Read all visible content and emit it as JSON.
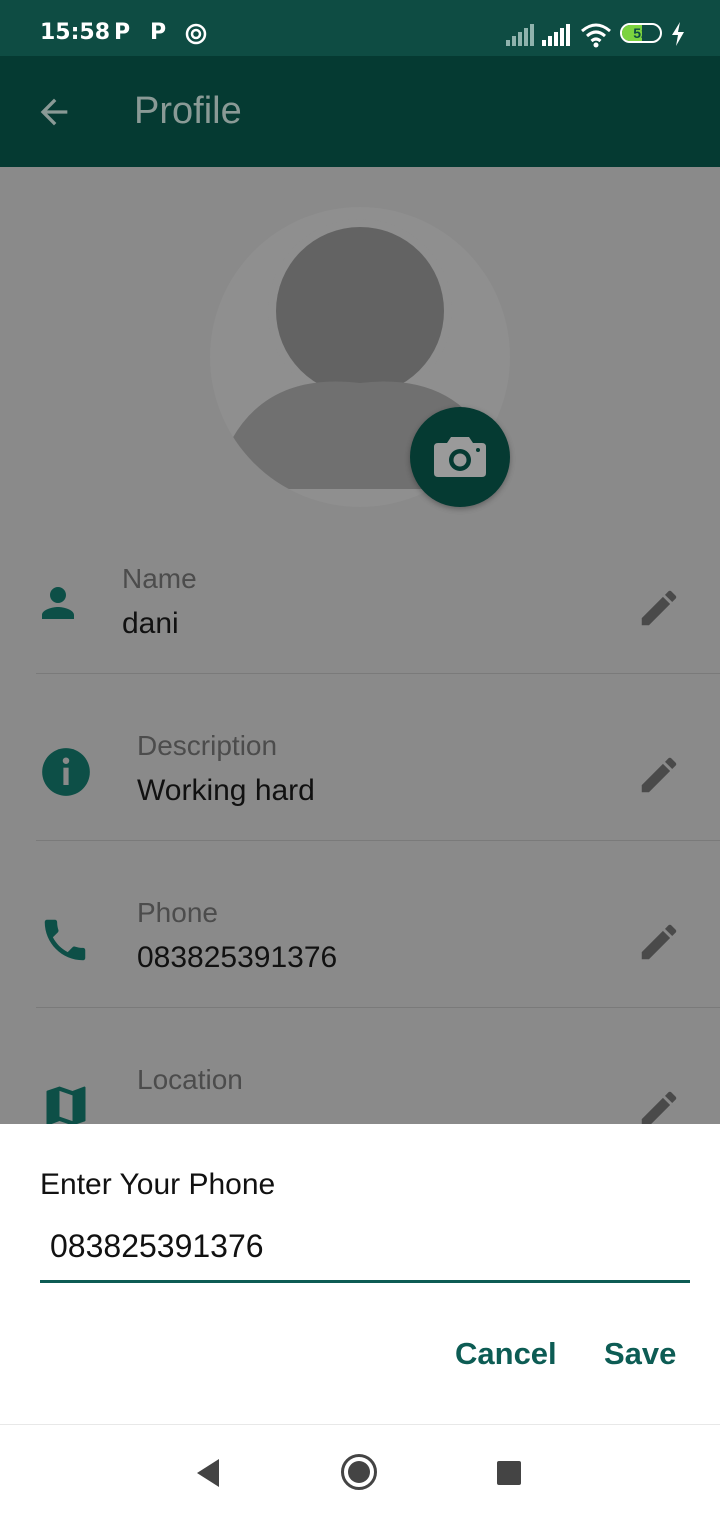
{
  "status_bar": {
    "time": "15:58",
    "battery": "52",
    "notif_p1": "P",
    "notif_p2": "P"
  },
  "app_bar": {
    "title": "Profile"
  },
  "profile": {
    "rows": [
      {
        "label": "Name",
        "value": "dani"
      },
      {
        "label": "Description",
        "value": "Working hard"
      },
      {
        "label": "Phone",
        "value": "083825391376"
      },
      {
        "label": "Location",
        "value": ""
      }
    ]
  },
  "dialog": {
    "title": "Enter Your Phone",
    "input_value": "083825391376",
    "cancel_label": "Cancel",
    "save_label": "Save"
  },
  "colors": {
    "primary": "#053a32",
    "accent": "#0d5c54",
    "status_bar": "#0e4c43"
  }
}
